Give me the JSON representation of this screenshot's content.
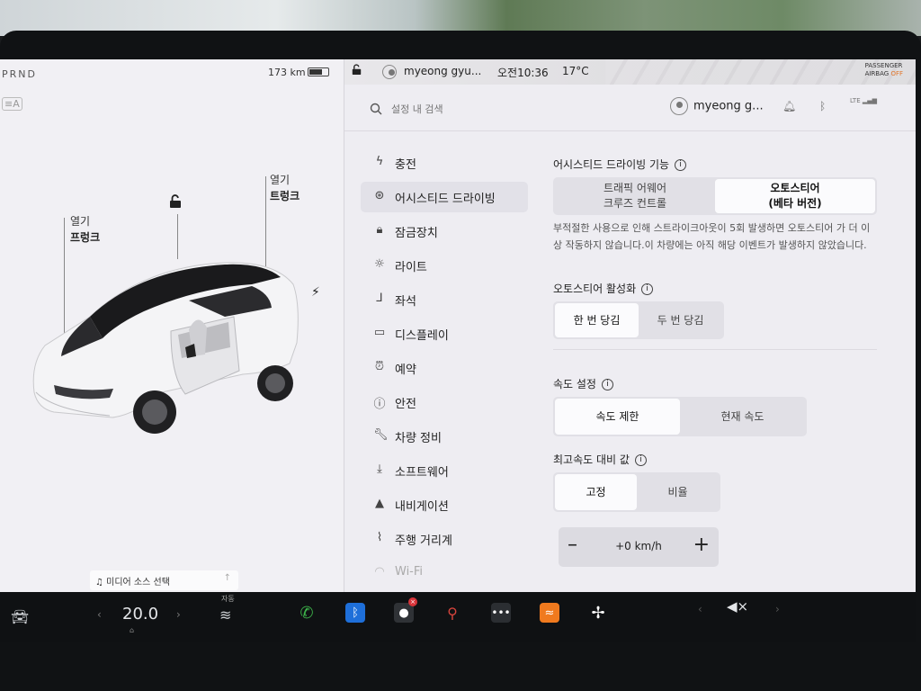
{
  "left_panel": {
    "gear": "PRND",
    "range": "173 km",
    "frunk": {
      "top": "열기",
      "bottom": "프렁크"
    },
    "trunk": {
      "top": "열기",
      "bottom": "트렁크"
    },
    "media_source": "미디어 소스 선택"
  },
  "status_bar": {
    "user": "myeong gyu...",
    "time": "오전10:36",
    "temperature": "17°C",
    "airbag_line1": "PASSENGER",
    "airbag_line2": "AIRBAG",
    "airbag_status": "OFF"
  },
  "header": {
    "search_placeholder": "설정 내 검색",
    "user": "myeong g...",
    "signal": "LTE"
  },
  "nav": {
    "items": [
      {
        "label": "충전",
        "icon": "bolt-icon"
      },
      {
        "label": "어시스티드 드라이빙",
        "icon": "steering-wheel-icon",
        "active": true
      },
      {
        "label": "잠금장치",
        "icon": "lock-icon"
      },
      {
        "label": "라이트",
        "icon": "sun-icon"
      },
      {
        "label": "좌석",
        "icon": "seat-icon"
      },
      {
        "label": "디스플레이",
        "icon": "display-icon"
      },
      {
        "label": "예약",
        "icon": "alarm-icon"
      },
      {
        "label": "안전",
        "icon": "alert-icon"
      },
      {
        "label": "차량 정비",
        "icon": "wrench-icon"
      },
      {
        "label": "소프트웨어",
        "icon": "download-icon"
      },
      {
        "label": "내비게이션",
        "icon": "navigation-icon"
      },
      {
        "label": "주행 거리계",
        "icon": "odometer-icon"
      },
      {
        "label": "Wi-Fi",
        "icon": "wifi-icon"
      }
    ]
  },
  "content": {
    "assist_title": "어시스티드 드라이빙 기능",
    "assist_opt1_line1": "트래픽 어웨어",
    "assist_opt1_line2": "크루즈 컨트롤",
    "assist_opt2_line1": "오토스티어",
    "assist_opt2_line2": "(베타 버전)",
    "assist_desc": "부적절한 사용으로 인해 스트라이크아웃이 5회 발생하면 오토스티어 가 더 이상 작동하지 않습니다.이 차량에는 아직 해당 이벤트가 발생하지 않았습니다.",
    "activation_title": "오토스티어 활성화",
    "activation_opt1": "한 번 당김",
    "activation_opt2": "두 번 당김",
    "speed_title": "속도 설정",
    "speed_opt1": "속도 제한",
    "speed_opt2": "현재 속도",
    "offset_title": "최고속도 대비 값",
    "offset_opt1": "고정",
    "offset_opt2": "비율",
    "offset_value": "+0 km/h"
  },
  "dock": {
    "temp": "20.0",
    "seat_label": "자동",
    "volume": "muted"
  },
  "colors": {
    "screen_bg": "#eeecf1",
    "selected_seg": "#fbfbfd",
    "phone": "#3db44a",
    "bluetooth": "#1e6fd9",
    "audible": "#f07a1e"
  }
}
